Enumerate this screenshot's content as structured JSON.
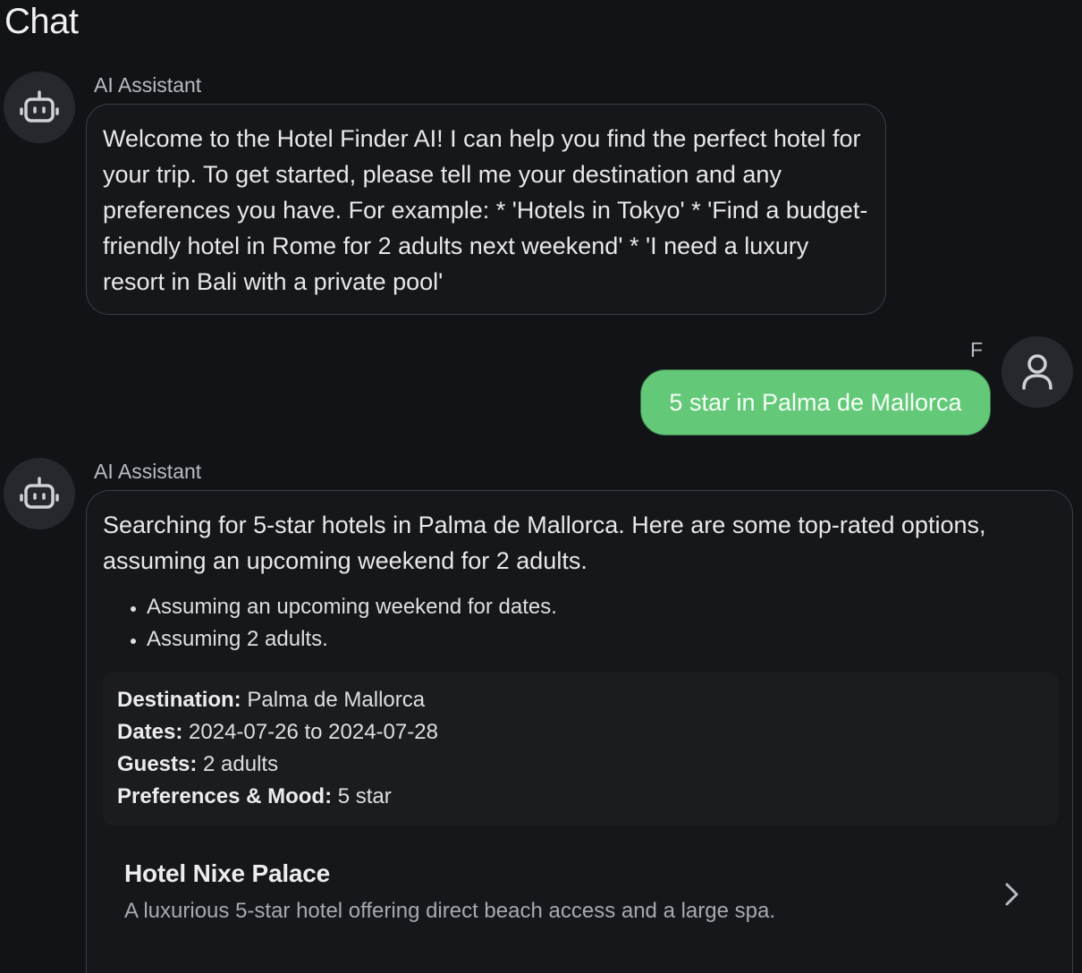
{
  "header": {
    "title": "Chat"
  },
  "messages": {
    "assistant1": {
      "sender": "AI Assistant",
      "text": "Welcome to the Hotel Finder AI! I can help you find the perfect hotel for your trip. To get started, please tell me your destination and any preferences you have. For example: * 'Hotels in Tokyo' * 'Find a budget-friendly hotel in Rome for 2 adults next weekend' * 'I need a luxury resort in Bali with a private pool'"
    },
    "user1": {
      "sender": "F",
      "text": "5 star in Palma de Mallorca"
    },
    "assistant2": {
      "sender": "AI Assistant",
      "text": "Searching for 5-star hotels in Palma de Mallorca. Here are some top-rated options, assuming an upcoming weekend for 2 adults.",
      "assumptions": [
        "Assuming an upcoming weekend for dates.",
        "Assuming 2 adults."
      ],
      "summary": {
        "destination_label": "Destination:",
        "destination": "Palma de Mallorca",
        "dates_label": "Dates:",
        "dates": "2024-07-26 to 2024-07-28",
        "guests_label": "Guests:",
        "guests": "2 adults",
        "prefs_label": "Preferences & Mood:",
        "prefs": "5 star"
      },
      "hotels": [
        {
          "name": "Hotel Nixe Palace",
          "description": "A luxurious 5-star hotel offering direct beach access and a large spa."
        }
      ]
    }
  },
  "icons": {
    "assistant_avatar": "robot-icon",
    "user_avatar": "user-icon",
    "hotel_open": "chevron-right-icon"
  },
  "colors": {
    "background": "#121316",
    "user_bubble": "#63c978",
    "bubble_border": "#3b3d43"
  }
}
